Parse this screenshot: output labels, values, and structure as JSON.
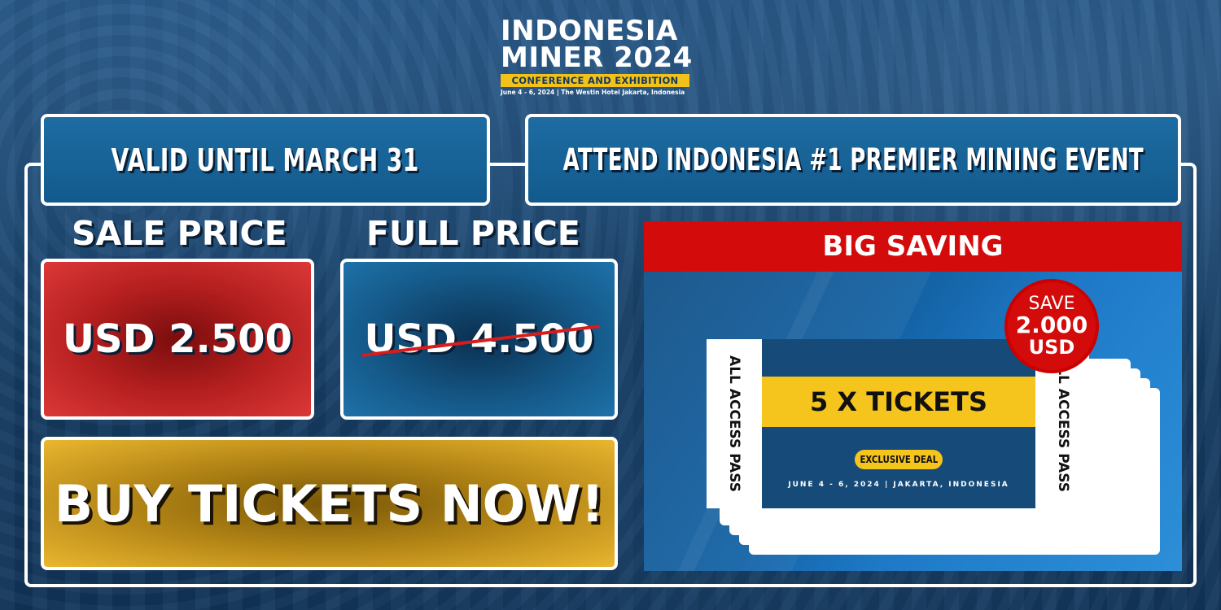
{
  "logo": {
    "line1": "INDONESIA",
    "line2": "MINER 2024",
    "tagline": "CONFERENCE AND EXHIBITION",
    "event_info": "June 4 - 6, 2024 | The Westin Hotel Jakarta, Indonesia"
  },
  "headers": {
    "valid": "VALID UNTIL MARCH 31",
    "attend": "ATTEND INDONESIA #1 PREMIER MINING EVENT"
  },
  "pricing": {
    "sale_label": "SALE PRICE",
    "sale_value": "USD 2.500",
    "full_label": "FULL PRICE",
    "full_value": "USD 4.500"
  },
  "cta": {
    "label": "BUY TICKETS NOW!"
  },
  "offer": {
    "heading": "BIG SAVING",
    "save_line1": "SAVE",
    "save_line2": "2.000",
    "save_line3": "USD",
    "ticket_count": "5 X TICKETS",
    "pass_label": "ALL ACCESS PASS",
    "badge": "EXCLUSIVE DEAL",
    "ticket_date": "JUNE 4 - 6, 2024 | JAKARTA, INDONESIA"
  },
  "colors": {
    "brand_blue": "#164a78",
    "accent_yellow": "#f5c51e",
    "sale_red": "#d40b0b",
    "gold": "#b98a18"
  }
}
